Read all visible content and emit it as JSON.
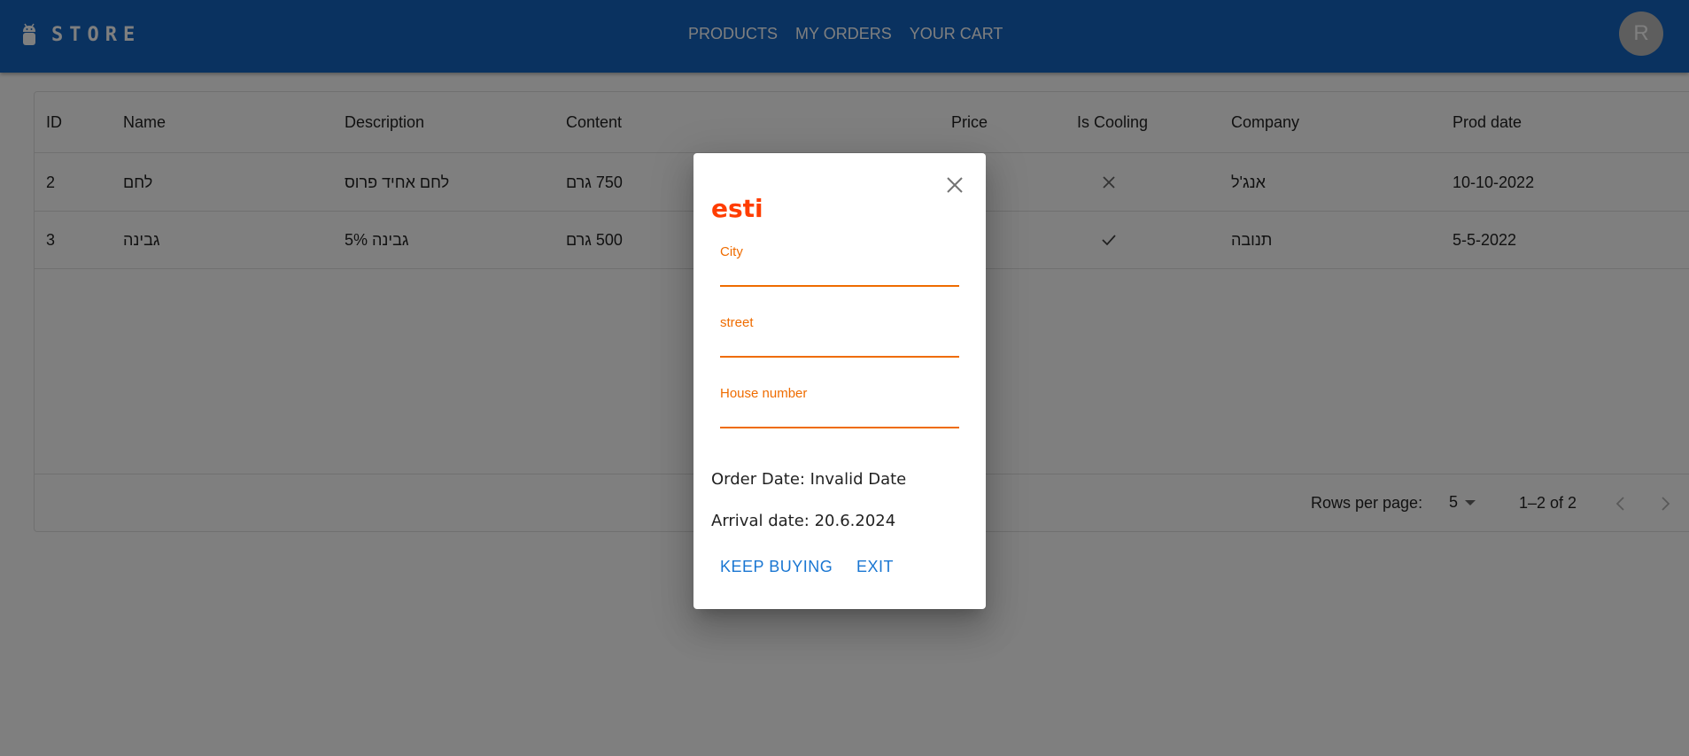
{
  "app": {
    "title": "STORE",
    "logo_icon": "android-icon",
    "nav": [
      "PRODUCTS",
      "MY ORDERS",
      "YOUR CART"
    ],
    "avatar_letter": "R",
    "colors": {
      "appbar": "#1565c0",
      "dialog_title": "#ff3d00",
      "field_accent": "#ef6c00",
      "button_text": "#1976d2"
    }
  },
  "table": {
    "headers": [
      "ID",
      "Name",
      "Description",
      "Content",
      "Price",
      "Is Cooling",
      "Company",
      "Prod date"
    ],
    "rows": [
      {
        "id": "2",
        "name": "לחם",
        "description": "לחם אחיד פרוס",
        "content": "750 גרם",
        "is_cooling": false,
        "cooling_icon": "close-icon",
        "company": "אנג'ל",
        "prod_date": "10-10-2022"
      },
      {
        "id": "3",
        "name": "גבינה",
        "description": "גבינה 5%",
        "content": "500 גרם",
        "is_cooling": true,
        "cooling_icon": "check-icon",
        "company": "תנובה",
        "prod_date": "5-5-2022"
      }
    ],
    "pagination": {
      "rows_per_page_label": "Rows per page:",
      "rows_per_page": "5",
      "range": "1–2 of 2"
    }
  },
  "dialog": {
    "title": "esti",
    "fields": [
      {
        "label": "City",
        "value": ""
      },
      {
        "label": "street",
        "value": ""
      },
      {
        "label": "House number",
        "value": ""
      }
    ],
    "order_date": "Order Date: Invalid Date",
    "arrival_date": "Arrival date: 20.6.2024",
    "keep_buying_label": "KEEP BUYING",
    "exit_label": "EXIT"
  }
}
